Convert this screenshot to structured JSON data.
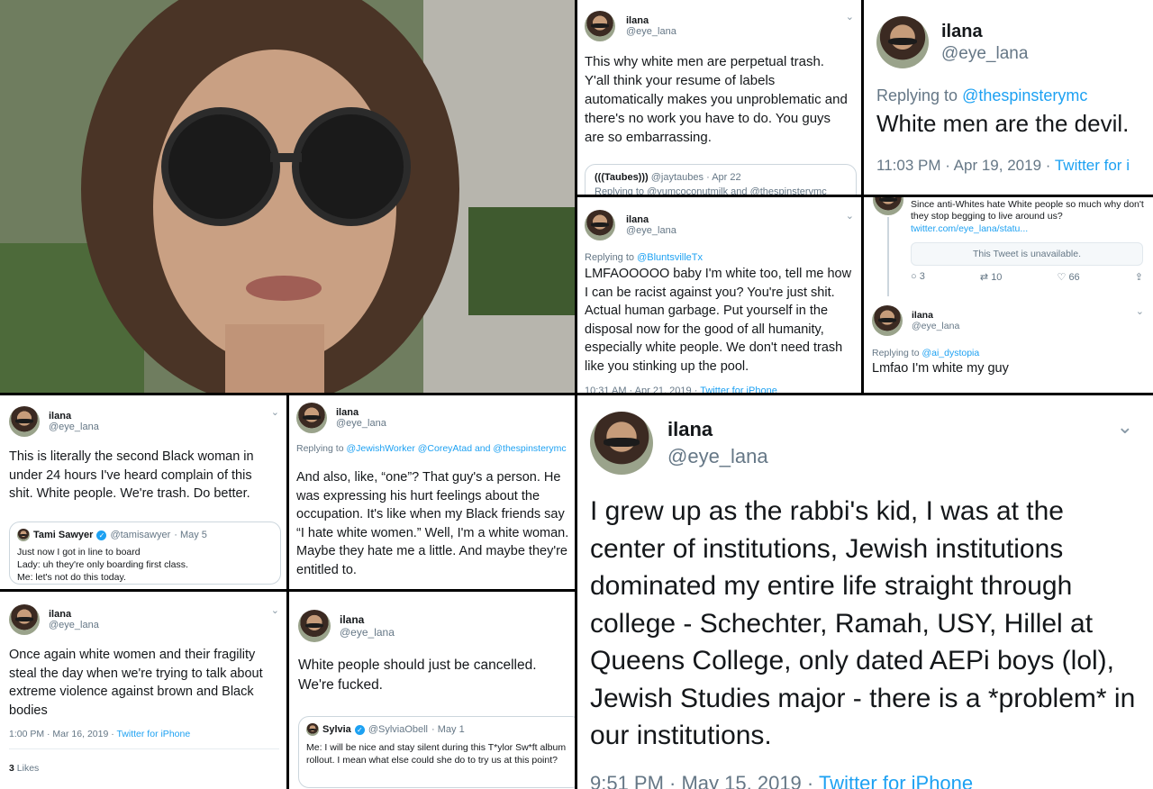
{
  "p2": {
    "name": "ilana",
    "handle": "@eye_lana",
    "text": "This why white men are perpetual trash. Y'all think your resume of labels automatically makes you unproblematic and there's no work you have to do. You guys are so embarrassing.",
    "quote": {
      "name": "(((Taubes)))",
      "handle": "@jaytaubes",
      "date": "· Apr 22",
      "reply": "Replying to @yumcoconutmilk and @thespinsterymc"
    }
  },
  "p3": {
    "name": "ilana",
    "handle": "@eye_lana",
    "reply_prefix": "Replying to",
    "reply_to": "@thespinsterymc",
    "text": "White men are the devil.",
    "meta": "11:03 PM · Apr 19, 2019 ·",
    "source": "Twitter for i"
  },
  "p4": {
    "name": "ilana",
    "handle": "@eye_lana",
    "reply_prefix": "Replying to",
    "reply_to": "@BluntsvilleTx",
    "text": "LMFAOOOOO baby I'm white too, tell me how I can be racist against you? You're just shit. Actual human garbage. Put yourself in the disposal now for the good of all humanity, especially white people. We don't need trash like you stinking up the pool.",
    "meta": "10:31 AM · Apr 21, 2019 ·",
    "source": "Twitter for iPhone"
  },
  "p5": {
    "parent_text": "Since anti-Whites hate White people so much why don't they stop begging to live around us?",
    "parent_link": "twitter.com/eye_lana/statu...",
    "unavailable": "This Tweet is unavailable.",
    "replies": "3",
    "retweets": "10",
    "likes": "66",
    "name": "ilana",
    "handle": "@eye_lana",
    "reply_prefix": "Replying to",
    "reply_to": "@ai_dystopia",
    "text": "Lmfao I'm white my guy"
  },
  "p6": {
    "name": "ilana",
    "handle": "@eye_lana",
    "text": "This is literally the second Black woman in under 24 hours I've heard complain of this shit. White people. We're trash. Do better.",
    "quote": {
      "name": "Tami Sawyer",
      "handle": "@tamisawyer",
      "date": "· May 5",
      "text": "Just now I got in line to board\nLady: uh they're only boarding first class.\nMe: let's not do this today."
    }
  },
  "p7": {
    "name": "ilana",
    "handle": "@eye_lana",
    "reply_prefix": "Replying to",
    "reply_to": "@JewishWorker @CoreyAtad and @thespinsterymc",
    "text": "And also, like, “one”? That guy's a person. He was expressing his hurt feelings about the occupation. It's like when my Black friends say “I hate white women.” Well, I'm a white woman. Maybe they hate me a little. And maybe they're entitled to."
  },
  "p8": {
    "name": "ilana",
    "handle": "@eye_lana",
    "text": "Once again white women and their fragility steal the day when we're trying to talk about extreme violence against brown and Black bodies",
    "meta": "1:00 PM · Mar 16, 2019 ·",
    "source": "Twitter for iPhone",
    "likes_count": "3",
    "likes_label": "Likes"
  },
  "p9": {
    "name": "ilana",
    "handle": "@eye_lana",
    "text": "White people should just be cancelled. We're fucked.",
    "quote": {
      "name": "Sylvia",
      "handle": "@SylviaObell",
      "date": "· May 1",
      "text": "Me: I will be nice and stay silent during this T*ylor Sw*ft album rollout. I mean what else could she do to try us at this point?"
    }
  },
  "p10": {
    "name": "ilana",
    "handle": "@eye_lana",
    "text": "I grew up as the rabbi's kid, I was at the center of institutions, Jewish institutions dominated my entire life straight through college - Schechter, Ramah, USY, Hillel at Queens College, only dated AEPi boys (lol), Jewish Studies major - there is a *problem* in our institutions.",
    "meta": "9:51 PM · May 15, 2019 ·",
    "source": "Twitter for iPhone"
  },
  "icons": {
    "chevron": "chevron-down-icon",
    "verified": "verified-badge-icon",
    "reply": "reply-icon",
    "retweet": "retweet-icon",
    "like": "heart-icon",
    "share": "share-icon"
  }
}
